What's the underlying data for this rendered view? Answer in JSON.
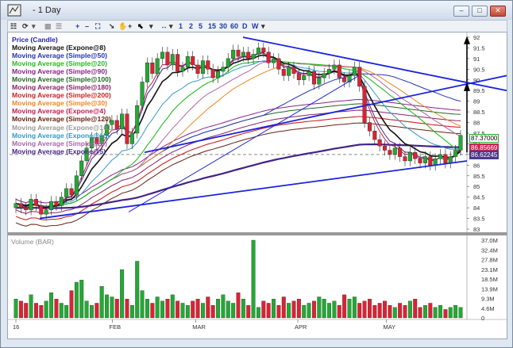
{
  "window": {
    "title": "- 1 Day",
    "minimize": "–",
    "maximize": "□",
    "close": "✕"
  },
  "toolbar": {
    "items": [
      "1",
      "2",
      "5",
      "15",
      "30",
      "60",
      "D",
      "W"
    ],
    "menu_label": "▾"
  },
  "legend": [
    {
      "label": "Price (Candle)",
      "color": "#2222bb"
    },
    {
      "label": "Moving Average (Expone@8)",
      "color": "#111111"
    },
    {
      "label": "Moving Average (Simple@50)",
      "color": "#2233bb"
    },
    {
      "label": "Moving Average (Simple@20)",
      "color": "#22bb22"
    },
    {
      "label": "Moving Average (Simple@90)",
      "color": "#882288"
    },
    {
      "label": "Moving Average (Simple@100)",
      "color": "#226622"
    },
    {
      "label": "Moving Average (Simple@180)",
      "color": "#882266"
    },
    {
      "label": "Moving Average (Simple@200)",
      "color": "#cc2222"
    },
    {
      "label": "Moving Average (Simple@30)",
      "color": "#ee8822"
    },
    {
      "label": "Moving Average (Expone@4)",
      "color": "#bb2255"
    },
    {
      "label": "Moving Average (Simple@120)",
      "color": "#662211"
    },
    {
      "label": "Moving Average (Expone@161)",
      "color": "#999999"
    },
    {
      "label": "Moving Average (Expone@15)",
      "color": "#3399cc"
    },
    {
      "label": "Moving Average (Simple@25)",
      "color": "#aa66aa"
    },
    {
      "label": "Moving Average (Expone@5)",
      "color": "#442288"
    }
  ],
  "volume_title": "Volume (BAR)",
  "price_axis": [
    "92",
    "91.5",
    "91",
    "90.5",
    "90",
    "89.5",
    "89",
    "88.5",
    "88",
    "87.5",
    "87",
    "86.5",
    "86",
    "85.5",
    "85",
    "84.5",
    "84",
    "83.5",
    "83"
  ],
  "volume_axis": [
    "37.0M",
    "32.4M",
    "27.8M",
    "23.1M",
    "18.5M",
    "13.9M",
    "9.3M",
    "4.6M",
    "0"
  ],
  "price_tags": [
    {
      "text": "87.37000",
      "bg": "#ffffff",
      "fg": "#000000",
      "border": "#22aa22"
    },
    {
      "text": "86.85669",
      "bg": "#cc2255",
      "fg": "#ffffff",
      "border": "#cc2255"
    },
    {
      "text": "86.62245",
      "bg": "#4a3a88",
      "fg": "#ffffff",
      "border": "#4a3a88"
    }
  ],
  "x_labels": [
    "16",
    "FEB",
    "MAR",
    "APR",
    "MAY"
  ],
  "chart_data": {
    "type": "candlestick",
    "ylim": [
      83,
      92
    ],
    "closes": [
      84.2,
      84.0,
      83.9,
      84.4,
      84.1,
      83.7,
      83.9,
      84.3,
      84.1,
      84.5,
      84.9,
      84.6,
      85.5,
      86.2,
      86.8,
      87.3,
      87.0,
      87.4,
      87.9,
      88.1,
      87.7,
      88.4,
      87.0,
      87.5,
      88.8,
      89.9,
      90.8,
      90.3,
      91.0,
      91.3,
      90.7,
      91.2,
      90.4,
      90.6,
      91.1,
      90.7,
      90.3,
      90.9,
      90.5,
      90.1,
      90.4,
      90.6,
      91.0,
      91.4,
      91.1,
      91.3,
      91.0,
      91.2,
      91.5,
      91.3,
      90.8,
      91.0,
      90.5,
      90.2,
      90.6,
      90.3,
      90.0,
      90.2,
      90.4,
      89.8,
      90.1,
      90.3,
      90.5,
      90.7,
      90.1,
      89.9,
      90.2,
      90.6,
      89.7,
      88.0,
      87.6,
      87.2,
      86.9,
      86.7,
      86.5,
      86.8,
      86.4,
      86.2,
      86.6,
      86.3,
      86.1,
      86.4,
      86.0,
      86.3,
      86.5,
      86.1,
      86.4,
      86.7,
      87.4
    ],
    "volume_M": [
      9,
      8,
      7,
      11,
      7,
      6,
      8,
      12,
      9,
      7,
      6,
      13,
      17,
      18,
      8,
      6,
      7,
      15,
      11,
      10,
      9,
      23,
      9,
      6,
      27,
      13,
      9,
      7,
      10,
      8,
      9,
      11,
      8,
      7,
      6,
      8,
      9,
      7,
      10,
      6,
      9,
      11,
      8,
      7,
      12,
      9,
      6,
      37,
      5,
      8,
      7,
      9,
      6,
      10,
      7,
      8,
      9,
      6,
      7,
      8,
      10,
      9,
      7,
      8,
      6,
      11,
      9,
      10,
      7,
      8,
      9,
      6,
      7,
      8,
      6,
      5,
      7,
      6,
      8,
      9,
      5,
      6,
      7,
      5,
      6,
      4,
      5,
      6,
      5
    ],
    "volume_ylim": [
      0,
      37
    ]
  }
}
